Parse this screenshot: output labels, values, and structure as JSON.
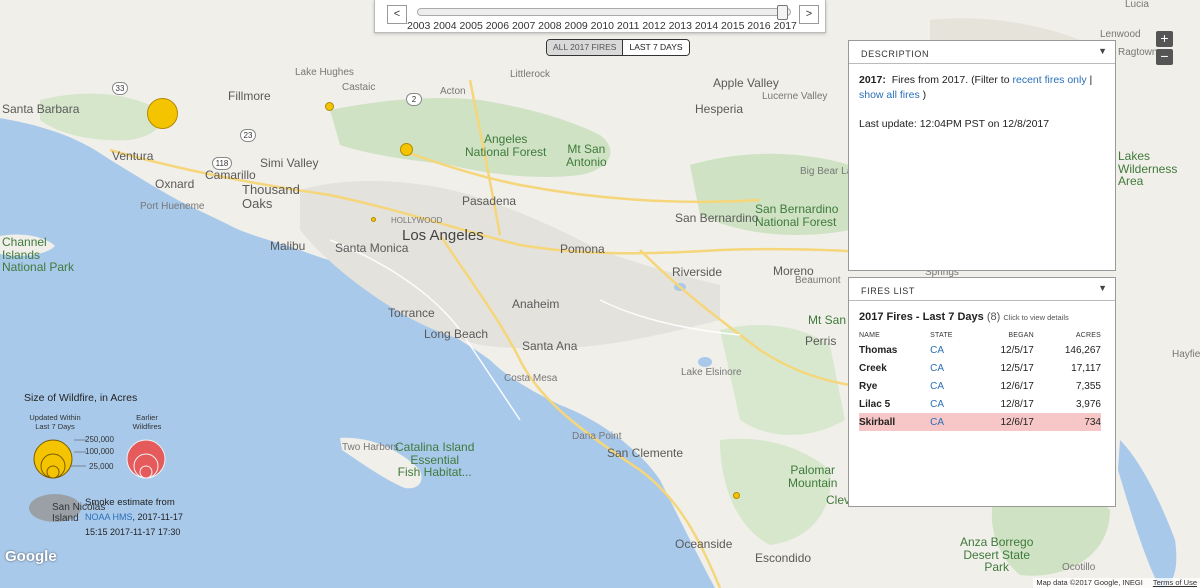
{
  "timeline": {
    "prev_label": "<",
    "next_label": ">",
    "years": [
      "2003",
      "2004",
      "2005",
      "2006",
      "2007",
      "2008",
      "2009",
      "2010",
      "2011",
      "2012",
      "2013",
      "2014",
      "2015",
      "2016",
      "2017"
    ],
    "selected_year": "2017"
  },
  "filter": {
    "all_label": "ALL 2017 FIRES",
    "recent_label": "LAST 7 DAYS",
    "active": "all"
  },
  "zoom": {
    "in_label": "+",
    "out_label": "−"
  },
  "description_panel": {
    "title": "DESCRIPTION",
    "caret": "▼",
    "year_label": "2017:",
    "text_before": "Fires from 2017. (Filter to ",
    "link_recent": "recent fires only",
    "separator": " | ",
    "link_all": "show all fires",
    "text_after": " )",
    "last_update": "Last update: 12:04PM PST on 12/8/2017"
  },
  "fires_panel": {
    "title": "FIRES LIST",
    "caret": "▼",
    "heading": "2017 Fires - Last 7 Days",
    "count": "(8)",
    "hint": "Click to view details",
    "columns": {
      "name": "NAME",
      "state": "STATE",
      "began": "BEGAN",
      "acres": "ACRES"
    },
    "rows": [
      {
        "name": "Thomas",
        "state": "CA",
        "began": "12/5/17",
        "acres": "146,267",
        "selected": false
      },
      {
        "name": "Creek",
        "state": "CA",
        "began": "12/5/17",
        "acres": "17,117",
        "selected": false
      },
      {
        "name": "Rye",
        "state": "CA",
        "began": "12/6/17",
        "acres": "7,355",
        "selected": false
      },
      {
        "name": "Lilac 5",
        "state": "CA",
        "began": "12/8/17",
        "acres": "3,976",
        "selected": false
      },
      {
        "name": "Skirball",
        "state": "CA",
        "began": "12/6/17",
        "acres": "734",
        "selected": true
      }
    ]
  },
  "legend": {
    "title": "Size of Wildfire, in Acres",
    "recent_label_1": "Updated Within",
    "recent_label_2": "Last 7 Days",
    "earlier_label_1": "Earlier",
    "earlier_label_2": "Wildfires",
    "size_values": [
      "250,000",
      "100,000",
      "25,000"
    ],
    "recent_color": "#f5c400",
    "earlier_color": "#e55a5a",
    "smoke_title": "Smoke estimate from",
    "smoke_source": "NOAA HMS",
    "smoke_line2_rest": ", 2017-11-17",
    "smoke_line3": "15:15 2017-11-17 17:30"
  },
  "map_labels": {
    "santa_barbara": "Santa Barbara",
    "ventura": "Ventura",
    "fillmore": "Fillmore",
    "oxnard": "Oxnard",
    "camarillo": "Camarillo",
    "port_hueneme": "Port Hueneme",
    "simi_valley": "Simi Valley",
    "thousand_oaks": "Thousand\nOaks",
    "malibu": "Malibu",
    "santa_monica": "Santa Monica",
    "hollywood": "HOLLYWOOD",
    "los_angeles": "Los Angeles",
    "pasadena": "Pasadena",
    "acton": "Acton",
    "littlerock": "Littlerock",
    "castaic": "Castaic",
    "angeles_nf": "Angeles\nNational Forest",
    "mt_san_antonio": "Mt San\nAntonio",
    "apple_valley": "Apple Valley",
    "hesperia": "Hesperia",
    "lucerne_valley": "Lucerne Valley",
    "big_bear": "Big Bear Lake",
    "san_bernardino": "San Bernardino",
    "sb_nf": "San Bernardino\nNational Forest",
    "pomona": "Pomona",
    "riverside": "Riverside",
    "torrance": "Torrance",
    "anaheim": "Anaheim",
    "long_beach": "Long Beach",
    "santa_ana": "Santa Ana",
    "costa_mesa": "Costa Mesa",
    "lake_elsinore": "Lake Elsinore",
    "moreno": "Moreno",
    "beaumont": "Beaumont",
    "mt_san_jacinto": "Mt San Jacinto",
    "perris": "Perris",
    "dana_point": "Dana Point",
    "san_clemente": "San Clemente",
    "two_harbors": "Two Harbors",
    "catalina": "Catalina Island\nEssential\nFish Habitat...",
    "channel_islands": "Channel\nIslands\nNational Park",
    "san_nicolas": "San Nicolas\nIsland",
    "oceanside": "Oceanside",
    "escondido": "Escondido",
    "palomar": "Palomar\nMountain",
    "cleve": "Cleve",
    "anza_borrego": "Anza Borrego\nDesert State\nPark",
    "ocotillo": "Ocotillo",
    "lenwood": "Lenwood",
    "ragtown": "Ragtown",
    "lucia": "Lucia",
    "joshua_lakes": "Lakes\nWilderness\nArea",
    "springs": "Springs",
    "hayfield": "Hayfield",
    "lake_hughes": "Lake Hughes"
  },
  "highway_shields": [
    "33",
    "23",
    "118",
    "2"
  ],
  "attribution": {
    "text": "Map data ©2017 Google, INEGI",
    "terms": "Terms of Use",
    "logo": "Google"
  }
}
